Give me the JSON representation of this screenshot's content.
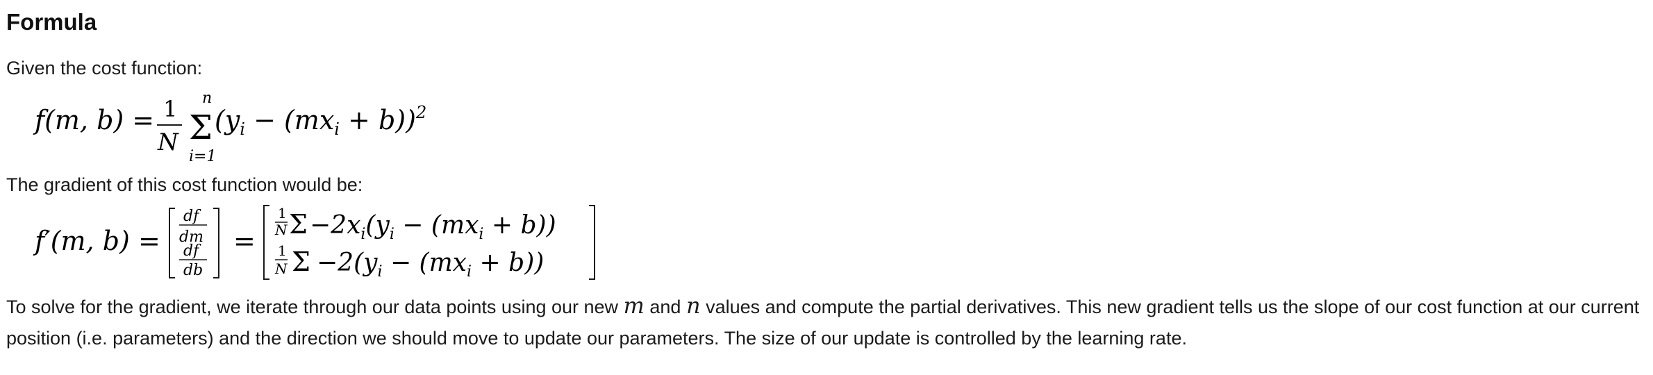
{
  "heading": "Formula",
  "intro_text": "Given the cost function:",
  "formula_cost": {
    "lhs": "f(m, b) =",
    "frac_num": "1",
    "frac_den": "N",
    "sum_upper": "n",
    "sum_lower": "i=1",
    "sum_symbol": "Σ",
    "body": "(y",
    "body_sub_i": "i",
    "body_mid": " − (mx",
    "body_sub_i2": "i",
    "body_end": " + b))",
    "power": "2"
  },
  "gradient_text": "The gradient of this cost function would be:",
  "formula_gradient": {
    "lhs": "f′(m, b) =",
    "df": "df",
    "dm": "dm",
    "db": "db",
    "equals": "=",
    "row1_num": "1",
    "row1_den": "N",
    "row1_sum": "Σ",
    "row1_body": "−2x",
    "row1_sub": "i",
    "row1_rest": "(y",
    "row1_sub2": "i",
    "row1_rest2": " − (mx",
    "row1_sub3": "i",
    "row1_end": " + b))",
    "row2_num": "1",
    "row2_den": "N",
    "row2_sum": "Σ",
    "row2_body": "−2(y",
    "row2_sub": "i",
    "row2_rest": " − (mx",
    "row2_sub2": "i",
    "row2_end": " + b))"
  },
  "explanation": {
    "part1": "To solve for the gradient, we iterate through our data points using our new ",
    "var_m": "m",
    "part2": " and ",
    "var_n": "n",
    "part3": " values and compute the partial derivatives. This new gradient tells us the slope of our cost function at our current position (i.e. parameters) and the direction we should move to update our parameters. The size of our update is controlled by the learning rate."
  }
}
